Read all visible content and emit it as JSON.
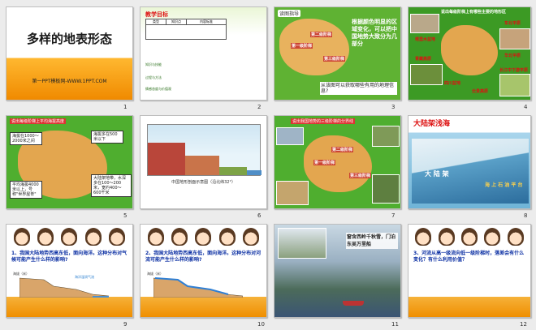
{
  "slides": [
    {
      "num": "1",
      "title": "多样的地表形态",
      "subtitle": "第一PPT模板网-WWW.1PPT.COM"
    },
    {
      "num": "2",
      "header": "教学目标",
      "table_heads": [
        "类型",
        "知识点",
        "内容标准"
      ],
      "rows": [
        "知识与技能",
        "过程与方法",
        "情感态度与价值观"
      ]
    },
    {
      "num": "3",
      "tag": "读图指导",
      "text": "根据颜色明显的区域变化，可以把中国地势大致分为几部分",
      "caption": "从该图可以获取哪些有用的地理信息?",
      "labels": [
        "第一级阶梯",
        "第二级阶梯",
        "第三级阶梯"
      ]
    },
    {
      "num": "4",
      "header": "说出每级阶梯上有哪些主要的地形区",
      "labels": [
        "塔里木盆地",
        "青藏高原",
        "东北平原",
        "华北平原",
        "长江中下游平原",
        "四川盆地",
        "云贵高原"
      ]
    },
    {
      "num": "5",
      "header": "说出每级阶梯上平均海拔高度",
      "callouts": [
        "海拔在1000～2000米之间",
        "海拔多在500米以下",
        "平均海拔4000米以上，号称\"世界屋脊\"",
        "大陆架地带，水深多在100～200米，宽约400～600千米"
      ],
      "labels": [
        "第一级阶梯",
        "第二级阶梯",
        "第三级阶梯"
      ]
    },
    {
      "num": "6",
      "caption": "中国地形剖面示意图（沿北纬32°）"
    },
    {
      "num": "7",
      "header": "说出我国地势的三级阶梯的分界线",
      "labels": [
        "第一级阶梯",
        "第二级阶梯",
        "第三级阶梯"
      ]
    },
    {
      "num": "8",
      "title": "大陆架浅海",
      "labels": [
        "大 陆 架",
        "海 上 石 油 平 台"
      ]
    },
    {
      "num": "9",
      "question": "1、我国大陆地势西高东低，面向海洋。这种分布对气候可能产生什么样的影响?",
      "axis": "海拔（米）",
      "arrow": "海洋湿润气流"
    },
    {
      "num": "10",
      "question": "2、我国大陆地势西高东低，面向海洋。这种分布对河流可能产生什么样的影响?",
      "axis": "海拔（米）"
    },
    {
      "num": "11",
      "poem": "窗含西岭千秋雪，门泊东吴万里船"
    },
    {
      "num": "12",
      "question": "3、河流从高一级流向低一级阶梯时，落差会有什么变化？有什么利用价值？"
    }
  ],
  "colors": {
    "accent": "#3a8f1e",
    "orange": "#f29100",
    "blue_text": "#0b2fa3",
    "red": "#d11111"
  }
}
